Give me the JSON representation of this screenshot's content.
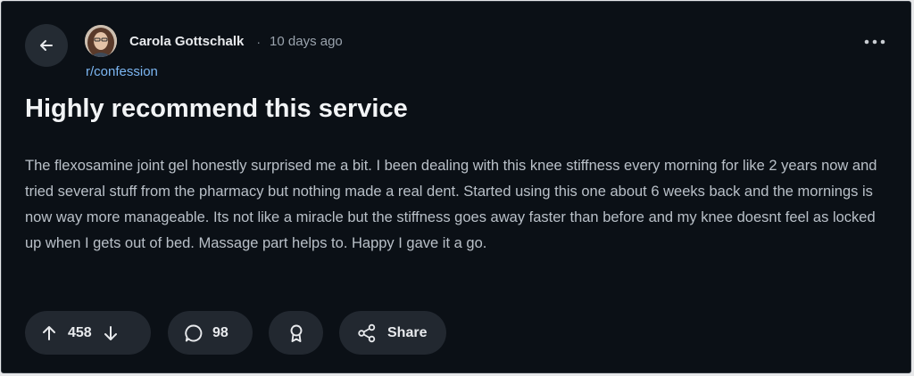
{
  "post": {
    "author": "Carola Gottschalk",
    "separator": "·",
    "time_ago": "10 days ago",
    "community": "r/confession",
    "title": "Highly recommend this service",
    "body": "The flexosamine joint gel honestly surprised me a bit. I been dealing with this knee stiffness every morning for like 2 years now and tried several stuff from the pharmacy but nothing made a real dent. Started using this one about 6 weeks back and the mornings is now way more manageable. Its not like a miracle but the stiffness goes away faster than before and my knee doesnt feel as locked up when I gets out of bed. Massage part helps to. Happy I gave it a go."
  },
  "actions": {
    "vote_count": "458",
    "comment_count": "98",
    "share_label": "Share"
  },
  "icons": {
    "back": "arrow-left-icon",
    "more": "more-horizontal-icon",
    "upvote": "arrow-up-icon",
    "downvote": "arrow-down-icon",
    "comment": "speech-bubble-icon",
    "award": "award-ribbon-icon",
    "share": "share-icon"
  },
  "colors": {
    "background": "#0b1016",
    "community_link": "#7cb6f2",
    "pill_background": "#222830"
  }
}
